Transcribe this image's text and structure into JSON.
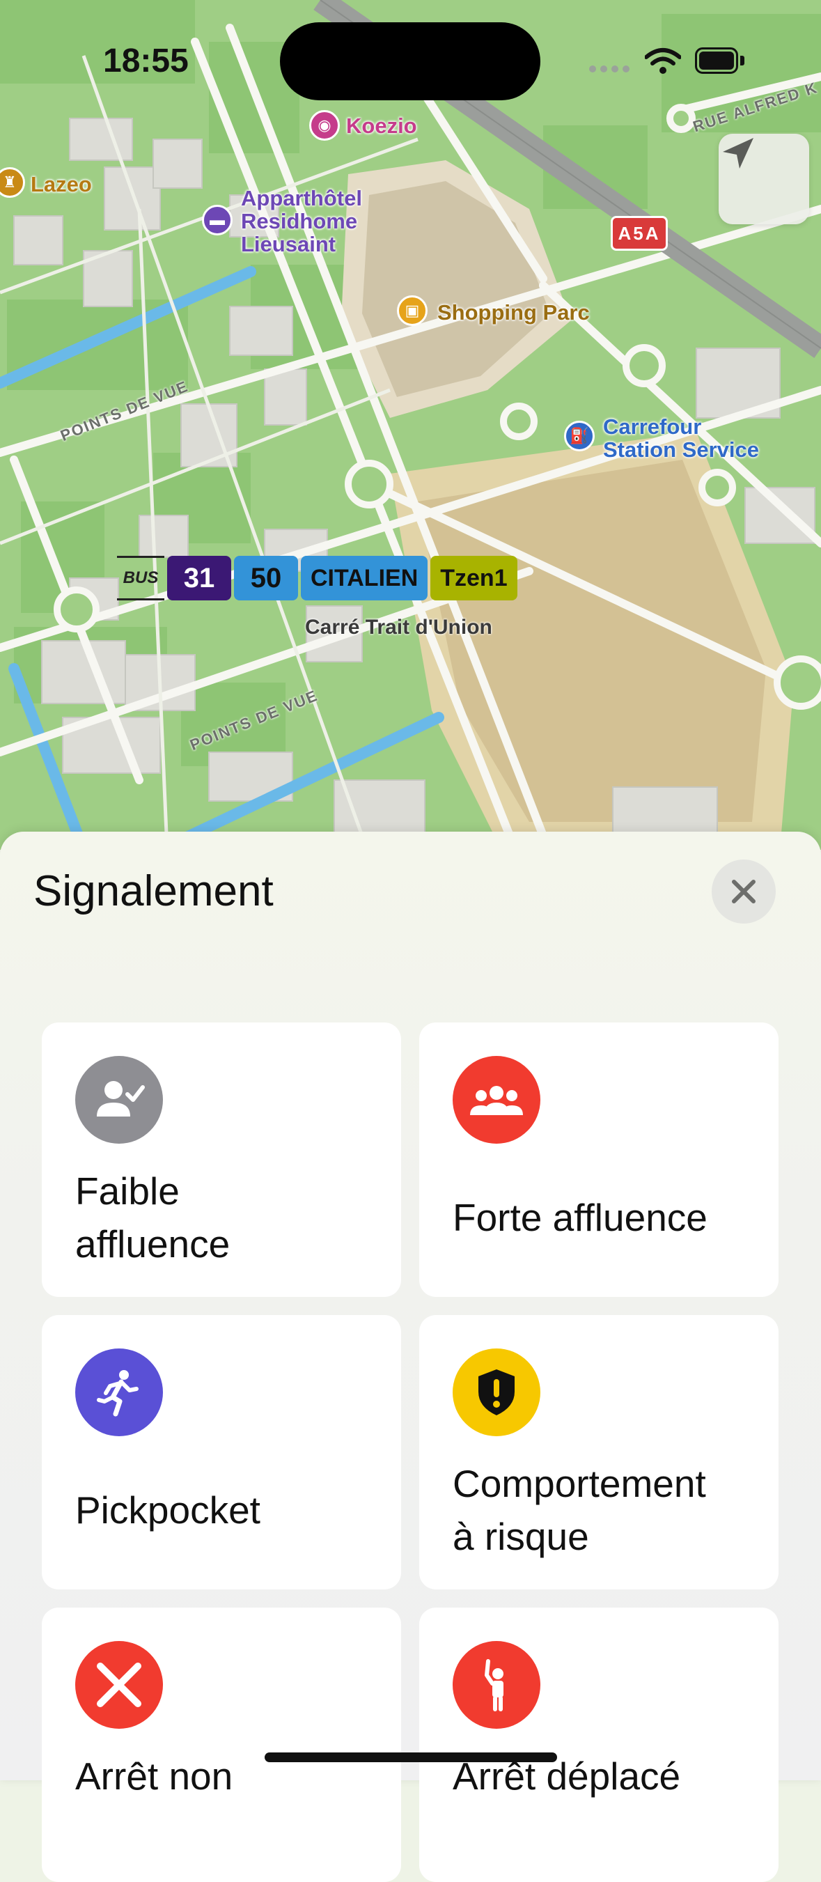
{
  "status_bar": {
    "time": "18:55"
  },
  "map": {
    "pois": [
      {
        "name": "Koezio",
        "color": "#c53c8b",
        "icon": "ticket-icon"
      },
      {
        "name": "Lazeo",
        "color": "#c98a16",
        "icon": "amusement-icon"
      },
      {
        "name_line1": "Apparthôtel",
        "name_line2": "Residhome",
        "name_line3": "Lieusaint",
        "color": "#6d47b5",
        "icon": "bed-icon"
      },
      {
        "name": "Shopping Parc",
        "color": "#9a6d12",
        "icon": "shopping-bag-icon"
      },
      {
        "name_line1": "Carrefour",
        "name_line2": "Station Service",
        "color": "#2f69c8",
        "icon": "fuel-icon"
      }
    ],
    "roads": [
      "POINTS DE VUE",
      "POINTS DE VUE",
      "RUE ALFRED K"
    ],
    "highway": "A5A",
    "bus_stop": {
      "mode_label": "BUS",
      "lines": [
        {
          "label": "31",
          "bg": "#3b1874",
          "fg": "#ffffff"
        },
        {
          "label": "50",
          "bg": "#3393d8",
          "fg": "#111111"
        },
        {
          "label": "CITALIEN",
          "bg": "#3393d8",
          "fg": "#111111"
        },
        {
          "label": "Tzen1",
          "bg": "#a8b300",
          "fg": "#111111"
        }
      ],
      "name": "Carré Trait d'Union"
    }
  },
  "sheet": {
    "title": "Signalement",
    "options": [
      {
        "label": "Faible affluence",
        "line1": "Faible",
        "line2": "affluence",
        "icon": "person-check-icon",
        "color": "#8e8e93"
      },
      {
        "label": "Forte affluence",
        "icon": "group-icon",
        "color": "#f13b2f"
      },
      {
        "label": "Pickpocket",
        "icon": "running-person-icon",
        "color": "#5a50d6"
      },
      {
        "label": "Comportement à risque",
        "line1": "Comportement",
        "line2": "à risque",
        "icon": "shield-exclamation-icon",
        "color": "#f7c800"
      },
      {
        "label": "Arrêt non",
        "icon": "x-mark-icon",
        "color": "#f13b2f"
      },
      {
        "label": "Arrêt déplacé",
        "icon": "person-hand-raised-icon",
        "color": "#f13b2f"
      }
    ]
  }
}
